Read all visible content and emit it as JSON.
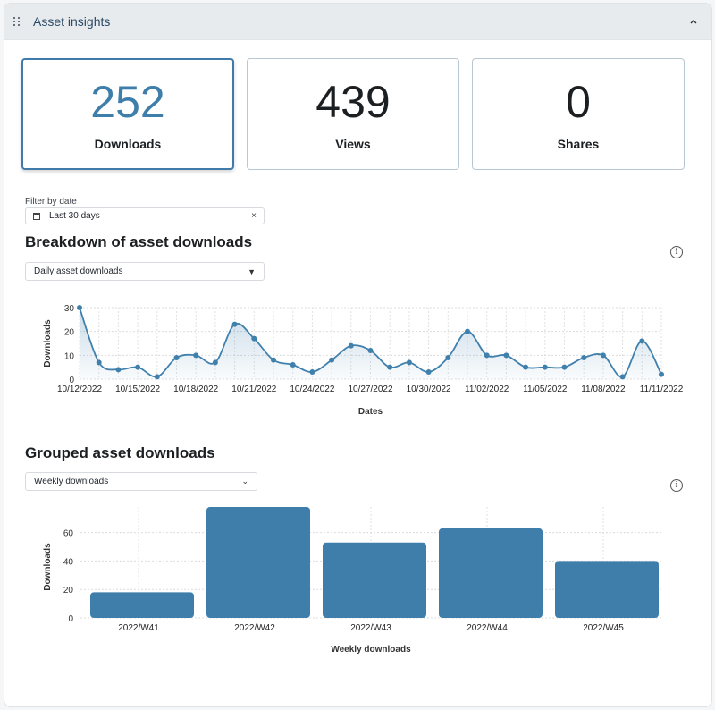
{
  "panel": {
    "title": "Asset insights",
    "collapse_icon": "chevron-up-icon",
    "drag_icon": "drag-handle-icon"
  },
  "stats": [
    {
      "value": "252",
      "label": "Downloads",
      "active": true
    },
    {
      "value": "439",
      "label": "Views",
      "active": false
    },
    {
      "value": "0",
      "label": "Shares",
      "active": false
    }
  ],
  "filter": {
    "label": "Filter by date",
    "value": "Last 30 days",
    "icon": "calendar-icon",
    "clear": "×"
  },
  "breakdown": {
    "title": "Breakdown of asset downloads",
    "select_value": "Daily asset downloads",
    "info": "i"
  },
  "grouped": {
    "title": "Grouped asset downloads",
    "select_value": "Weekly downloads",
    "info": "i"
  },
  "colors": {
    "accent": "#3f7eaa",
    "series": "#4080ad",
    "bar": "#3f7eaa"
  },
  "chart_data": [
    {
      "type": "area",
      "title": "Breakdown of asset downloads",
      "xlabel": "Dates",
      "ylabel": "Downloads",
      "ylim": [
        0,
        30
      ],
      "yticks": [
        0,
        10,
        20,
        30
      ],
      "x": [
        "10/12/2022",
        "10/13/2022",
        "10/14/2022",
        "10/15/2022",
        "10/16/2022",
        "10/17/2022",
        "10/18/2022",
        "10/19/2022",
        "10/20/2022",
        "10/21/2022",
        "10/22/2022",
        "10/23/2022",
        "10/24/2022",
        "10/25/2022",
        "10/26/2022",
        "10/27/2022",
        "10/28/2022",
        "10/29/2022",
        "10/30/2022",
        "10/31/2022",
        "11/01/2022",
        "11/02/2022",
        "11/03/2022",
        "11/04/2022",
        "11/05/2022",
        "11/06/2022",
        "11/07/2022",
        "11/08/2022",
        "11/09/2022",
        "11/10/2022",
        "11/11/2022"
      ],
      "xtick_labels": [
        "10/12/2022",
        "10/15/2022",
        "10/18/2022",
        "10/21/2022",
        "10/24/2022",
        "10/27/2022",
        "10/30/2022",
        "11/02/2022",
        "11/05/2022",
        "11/08/2022",
        "11/11/2022"
      ],
      "values": [
        30,
        7,
        4,
        5,
        1,
        9,
        10,
        7,
        23,
        17,
        8,
        6,
        3,
        8,
        14,
        12,
        5,
        7,
        3,
        9,
        20,
        10,
        10,
        5,
        5,
        5,
        9,
        10,
        1,
        16,
        2
      ],
      "grid": true
    },
    {
      "type": "bar",
      "title": "Grouped asset downloads",
      "xlabel": "Weekly downloads",
      "ylabel": "Downloads",
      "ylim": [
        0,
        78
      ],
      "yticks": [
        0,
        20,
        40,
        60
      ],
      "categories": [
        "2022/W41",
        "2022/W42",
        "2022/W43",
        "2022/W44",
        "2022/W45"
      ],
      "values": [
        18,
        78,
        53,
        63,
        40
      ],
      "grid": true
    }
  ]
}
